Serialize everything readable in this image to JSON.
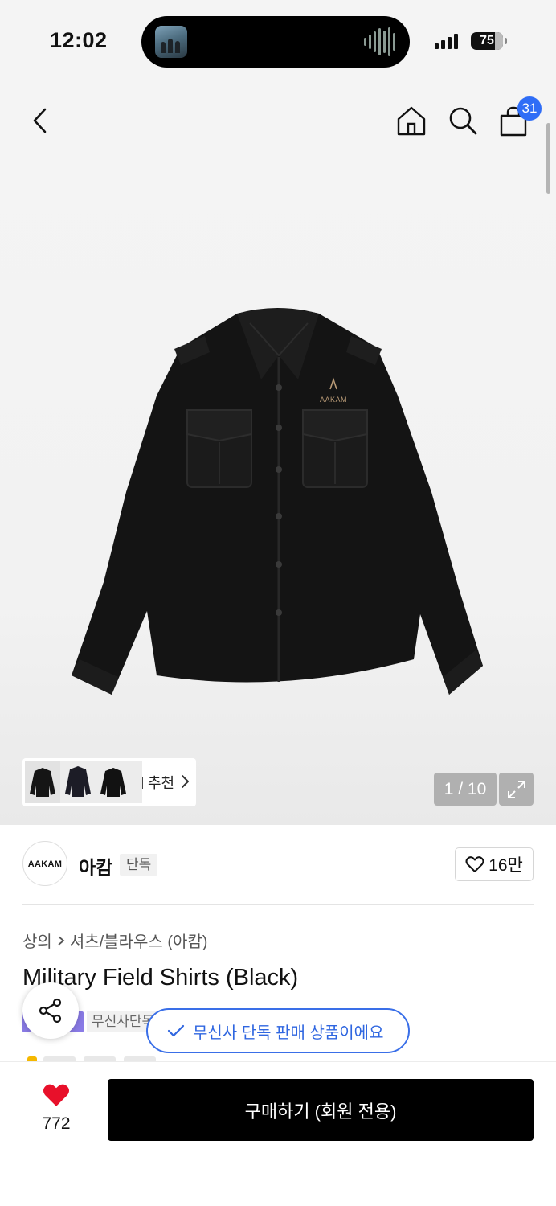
{
  "status_bar": {
    "time": "12:02",
    "battery": "75"
  },
  "header": {
    "cart_count": "31",
    "icons": [
      "back-icon",
      "home-icon",
      "search-icon",
      "bag-icon"
    ]
  },
  "gallery": {
    "recommend_label": "추천",
    "page_indicator": "1 / 10",
    "product_logo_text": "AAKAM"
  },
  "brand": {
    "logo_text": "AAKAM",
    "name": "아캄",
    "tag": "단독",
    "like_count": "16만"
  },
  "breadcrumb": {
    "items": [
      "상의",
      "셔츠/블라우스 (아캄)"
    ]
  },
  "product": {
    "title": "Military Field Shirts (Black)",
    "badge_text": "무신사단독"
  },
  "toast": {
    "text": "무신사 단독 판매 상품이에요"
  },
  "bottom_bar": {
    "like_count": "772",
    "buy_label": "구매하기 (회원 전용)"
  },
  "colors": {
    "accent_blue": "#2f6df6",
    "heart_red": "#e8102a",
    "buy_button": "#000000"
  }
}
